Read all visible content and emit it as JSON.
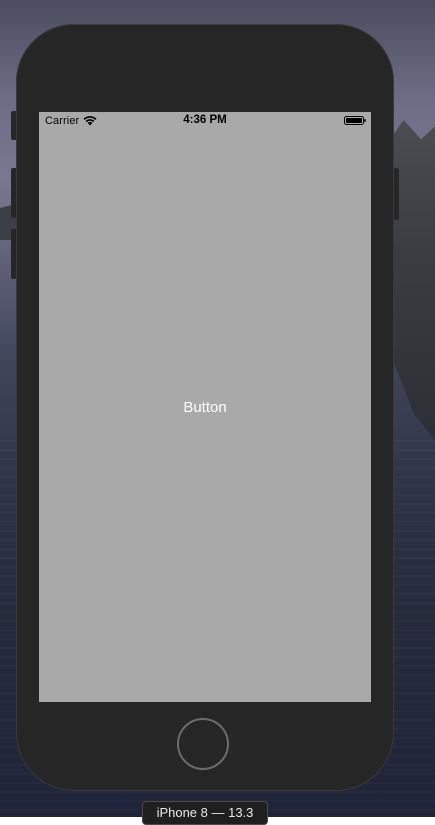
{
  "status_bar": {
    "carrier": "Carrier",
    "time": "4:36 PM",
    "wifi_icon": "wifi-icon",
    "battery_icon": "battery-icon"
  },
  "screen": {
    "background": "#a9a9a9",
    "button_label": "Button",
    "button_color": "#ffffff"
  },
  "device": {
    "home_button_icon": "home-button-ring",
    "simulator_label": "iPhone 8 — 13.3"
  }
}
